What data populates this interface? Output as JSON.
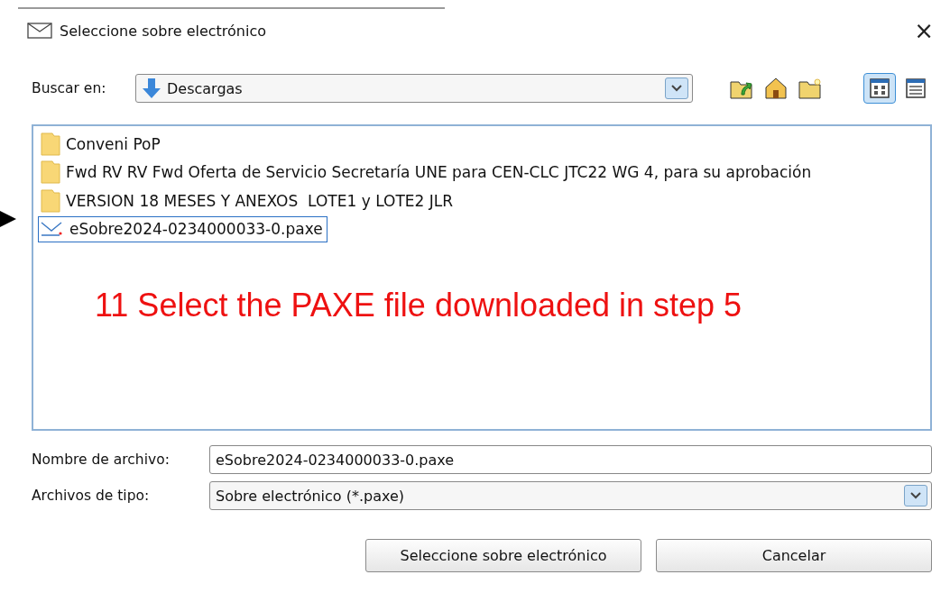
{
  "window": {
    "title": "Seleccione sobre electrónico",
    "close": "×"
  },
  "look_in": {
    "label": "Buscar en:",
    "value": "Descargas"
  },
  "views": [
    {
      "kind": "icons",
      "selected": true
    },
    {
      "kind": "details",
      "selected": false
    }
  ],
  "files": [
    {
      "kind": "folder",
      "name": "Conveni PoP",
      "selected": false
    },
    {
      "kind": "folder",
      "name": "Fwd RV RV Fwd Oferta de Servicio Secretaría UNE para CEN-CLC JTC22 WG 4, para su aprobación",
      "selected": false
    },
    {
      "kind": "folder",
      "name": "VERSION 18 MESES Y ANEXOS  LOTE1 y LOTE2 JLR",
      "selected": false
    },
    {
      "kind": "envelope",
      "name": "eSobre2024-0234000033-0.paxe",
      "selected": true
    }
  ],
  "annotation": "11 Select the PAXE file downloaded in step 5",
  "file_name": {
    "label": "Nombre de archivo:",
    "value": "eSobre2024-0234000033-0.paxe"
  },
  "file_type": {
    "label": "Archivos de tipo:",
    "value": "Sobre electrónico (*.paxe)"
  },
  "buttons": [
    "Seleccione sobre electrónico",
    "Cancelar"
  ]
}
